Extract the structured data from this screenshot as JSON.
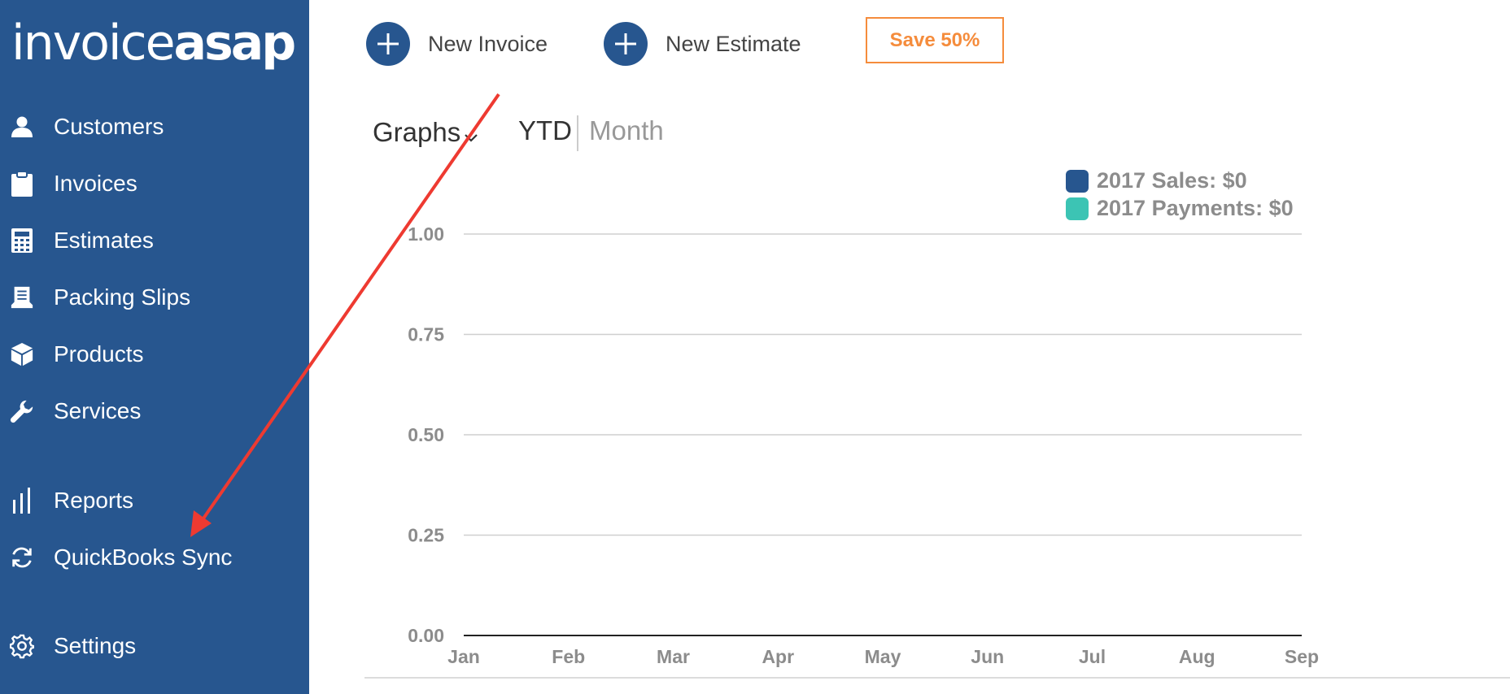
{
  "sidebar": {
    "logo": {
      "part1": "invoice",
      "part2": "asap"
    },
    "items": [
      {
        "label": "Customers",
        "icon": "user-icon"
      },
      {
        "label": "Invoices",
        "icon": "clipboard-icon"
      },
      {
        "label": "Estimates",
        "icon": "calculator-icon"
      },
      {
        "label": "Packing Slips",
        "icon": "packing-slip-icon"
      },
      {
        "label": "Products",
        "icon": "box-icon"
      },
      {
        "label": "Services",
        "icon": "wrench-icon"
      },
      {
        "label": "Reports",
        "icon": "bar-chart-icon"
      },
      {
        "label": "QuickBooks Sync",
        "icon": "sync-icon"
      },
      {
        "label": "Settings",
        "icon": "gear-icon"
      }
    ]
  },
  "toolbar": {
    "new_invoice": "New Invoice",
    "new_estimate": "New Estimate",
    "save": "Save 50%"
  },
  "graph_controls": {
    "graphs": "Graphs",
    "ytd": "YTD",
    "month": "Month"
  },
  "colors": {
    "sidebar": "#27568f",
    "accent_orange": "#f58c3c",
    "sales": "#27568f",
    "payments": "#3cc4b4",
    "annotation_arrow": "#ee3a31"
  },
  "chart_data": {
    "type": "line",
    "title": "",
    "xlabel": "",
    "ylabel": "",
    "categories": [
      "Jan",
      "Feb",
      "Mar",
      "Apr",
      "May",
      "Jun",
      "Jul",
      "Aug",
      "Sep"
    ],
    "y_ticks": [
      "0.00",
      "0.25",
      "0.50",
      "0.75",
      "1.00"
    ],
    "ylim": [
      0,
      1
    ],
    "grid": true,
    "legend_position": "top-right",
    "series": [
      {
        "name": "2017 Sales: $0",
        "color": "#27568f",
        "values": []
      },
      {
        "name": "2017 Payments: $0",
        "color": "#3cc4b4",
        "values": []
      }
    ]
  }
}
